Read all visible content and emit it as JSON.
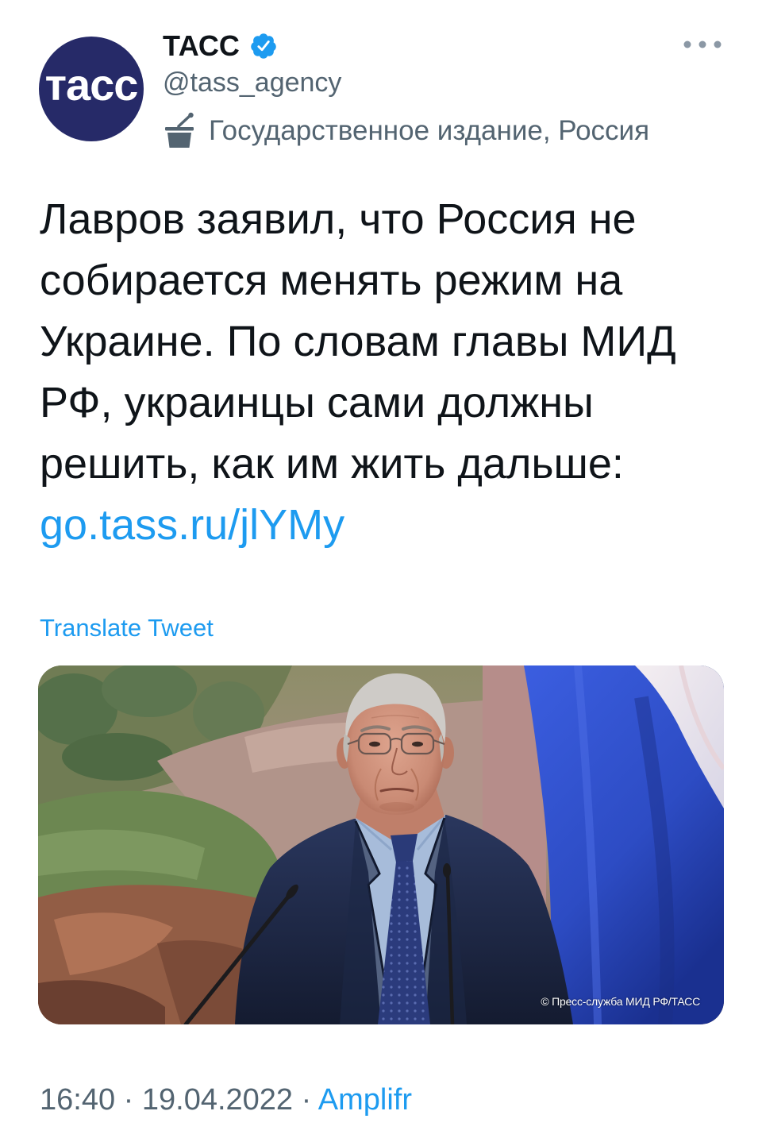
{
  "author": {
    "avatar_text": "тасс",
    "name": "ТАСС",
    "handle": "@tass_agency",
    "label": "Государственное издание, Россия"
  },
  "tweet": {
    "text_lines": [
      "Лавров заявил, что Россия не",
      "собирается менять режим на",
      "Украине. По словам главы МИД",
      "РФ, украинцы сами должны",
      "решить, как им жить дальше:"
    ],
    "link": "go.tass.ru/jlYMy",
    "translate_label": "Translate Tweet"
  },
  "media": {
    "caption": "© Пресс-служба МИД РФ/ТАСС"
  },
  "meta": {
    "time": "16:40",
    "separator": "·",
    "date": "19.04.2022",
    "source": "Amplifr"
  },
  "icons": {
    "verified": "verified-badge-icon",
    "label": "state-media-podium-icon",
    "more": "more-horizontal-icon"
  },
  "colors": {
    "text": "#0f1419",
    "muted": "#536471",
    "accent": "#1d9bf0",
    "avatar_bg": "#262a68"
  }
}
